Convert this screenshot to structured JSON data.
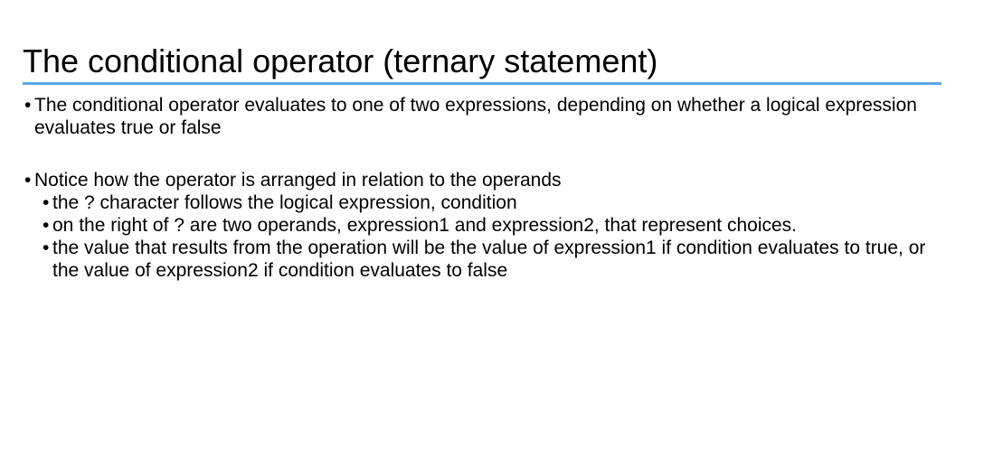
{
  "slide": {
    "title": "The conditional operator (ternary statement)",
    "accent_color": "#5aa6e6",
    "bullets": [
      {
        "level": 1,
        "text": "The conditional operator evaluates to one of two expressions, depending on whether a logical expression evaluates true or false"
      },
      {
        "level": 1,
        "text": "Notice how the operator is arranged in relation to the operands"
      },
      {
        "level": 2,
        "text": "the ? character follows the logical expression, condition"
      },
      {
        "level": 2,
        "text": "on the right of ? are two operands, expression1 and expression2, that represent choices."
      },
      {
        "level": 2,
        "text": "the value that results from the operation will be the value of expression1 if condition evaluates to true, or the value of expression2 if condition evaluates to false"
      }
    ],
    "bullet_glyph": "•"
  }
}
